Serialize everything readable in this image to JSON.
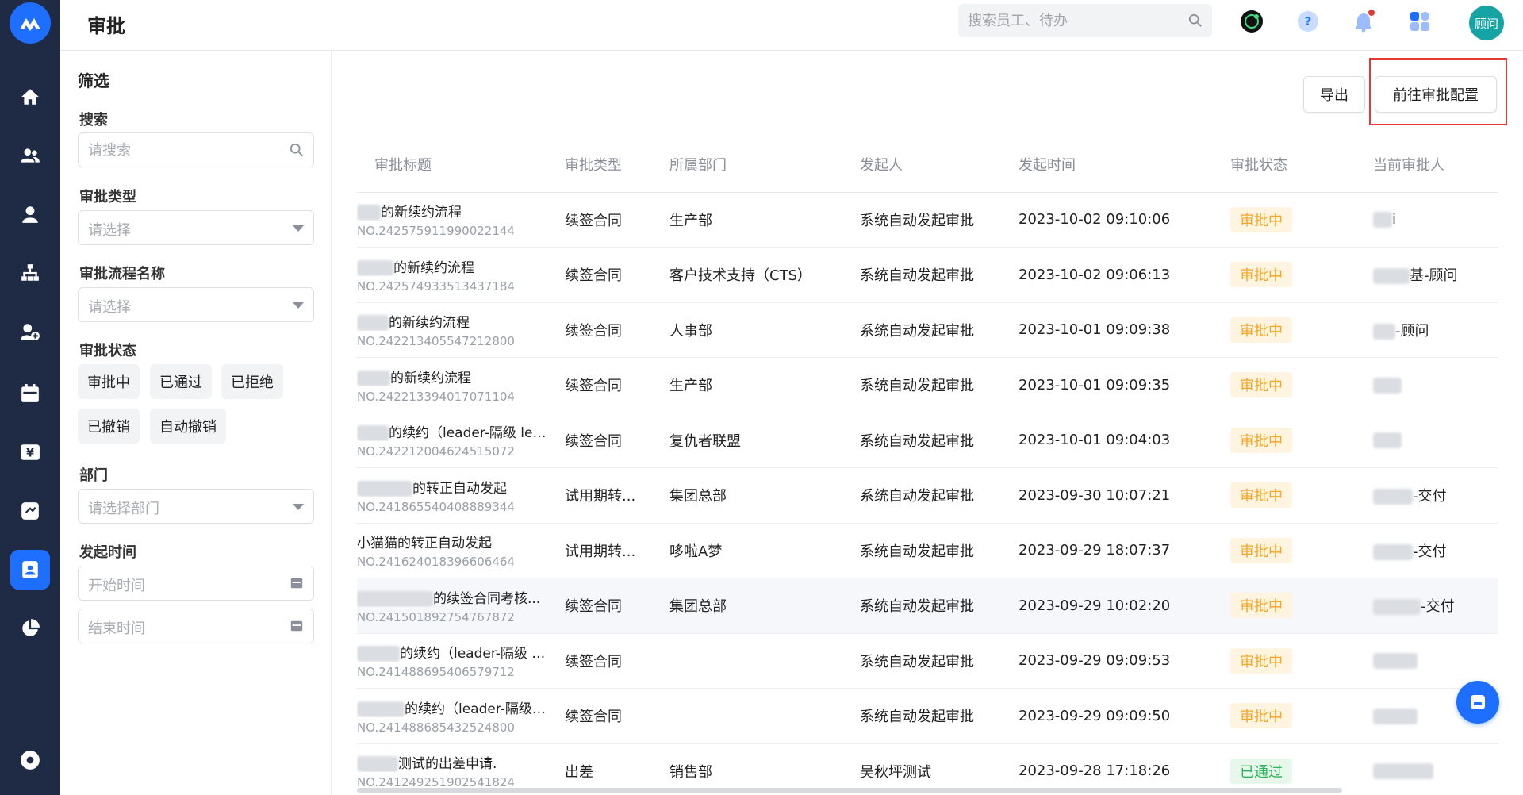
{
  "app": {
    "title": "审批"
  },
  "header": {
    "search_placeholder": "搜索员工、待办",
    "user_avatar": "顾问",
    "icons": [
      "ai-assistant-icon",
      "help-icon",
      "bell-icon",
      "apps-grid-icon"
    ]
  },
  "nav": {
    "items": [
      "home-icon",
      "users-icon",
      "user-icon",
      "org-chart-icon",
      "user-add-icon",
      "calendar-icon",
      "yen-icon",
      "exchange-icon",
      "approval-icon",
      "pie-chart-icon",
      "settings-icon"
    ],
    "active": "approval-icon"
  },
  "filter": {
    "title": "筛选",
    "search_label": "搜索",
    "search_placeholder": "请搜索",
    "type_label": "审批类型",
    "type_placeholder": "请选择",
    "flow_label": "审批流程名称",
    "flow_placeholder": "请选择",
    "status_label": "审批状态",
    "status_chips": [
      "审批中",
      "已通过",
      "已拒绝",
      "已撤销",
      "自动撤销"
    ],
    "dept_label": "部门",
    "dept_placeholder": "请选择部门",
    "time_label": "发起时间",
    "start_placeholder": "开始时间",
    "end_placeholder": "结束时间"
  },
  "toolbar": {
    "export_label": "导出",
    "config_label": "前往审批配置"
  },
  "table": {
    "columns": [
      "审批标题",
      "审批类型",
      "所属部门",
      "发起人",
      "发起时间",
      "审批状态",
      "当前审批人"
    ],
    "rows": [
      {
        "title": "的新续约流程",
        "no": "NO.242575911990022144",
        "type": "续签合同",
        "dept": "生产部",
        "initiator": "系统自动发起审批",
        "time": "2023-10-02 09:10:06",
        "status": "审批中",
        "approver": "i"
      },
      {
        "title": "的新续约流程",
        "no": "NO.242574933513437184",
        "type": "续签合同",
        "dept": "客户技术支持（CTS）",
        "initiator": "系统自动发起审批",
        "time": "2023-10-02 09:06:13",
        "status": "审批中",
        "approver": "基-顾问"
      },
      {
        "title": "的新续约流程",
        "no": "NO.242213405547212800",
        "type": "续签合同",
        "dept": "人事部",
        "initiator": "系统自动发起审批",
        "time": "2023-10-01 09:09:38",
        "status": "审批中",
        "approver": "-顾问"
      },
      {
        "title": "的新续约流程",
        "no": "NO.242213394017071104",
        "type": "续签合同",
        "dept": "生产部",
        "initiator": "系统自动发起审批",
        "time": "2023-10-01 09:09:35",
        "status": "审批中",
        "approver": ""
      },
      {
        "title": "的续约（leader-隔级 lea...",
        "no": "NO.242212004624515072",
        "type": "续签合同",
        "dept": "复仇者联盟",
        "initiator": "系统自动发起审批",
        "time": "2023-10-01 09:04:03",
        "status": "审批中",
        "approver": ""
      },
      {
        "title": "的转正自动发起",
        "no": "NO.241865540408889344",
        "type": "试用期转...",
        "dept": "集团总部",
        "initiator": "系统自动发起审批",
        "time": "2023-09-30 10:07:21",
        "status": "审批中",
        "approver": "-交付"
      },
      {
        "title": "小猫猫的转正自动发起",
        "no": "NO.241624018396606464",
        "type": "试用期转...",
        "dept": "哆啦A梦",
        "initiator": "系统自动发起审批",
        "time": "2023-09-29 18:07:37",
        "status": "审批中",
        "approver": "-交付"
      },
      {
        "title": "的续签合同考核...",
        "no": "NO.241501892754767872",
        "type": "续签合同",
        "dept": "集团总部",
        "initiator": "系统自动发起审批",
        "time": "2023-09-29 10:02:20",
        "status": "审批中",
        "approver": "-交付"
      },
      {
        "title": "的续约（leader-隔级 l...",
        "no": "NO.241488695406579712",
        "type": "续签合同",
        "dept": "",
        "initiator": "系统自动发起审批",
        "time": "2023-09-29 09:09:53",
        "status": "审批中",
        "approver": ""
      },
      {
        "title": "的续约（leader-隔级 l...",
        "no": "NO.241488685432524800",
        "type": "续签合同",
        "dept": "",
        "initiator": "系统自动发起审批",
        "time": "2023-09-29 09:09:50",
        "status": "审批中",
        "approver": ""
      },
      {
        "title": "测试的出差申请.",
        "no": "NO.241249251902541824",
        "type": "出差",
        "dept": "销售部",
        "initiator": "吴秋坪测试",
        "time": "2023-09-28 17:18:26",
        "status": "已通过",
        "approver": ""
      }
    ]
  },
  "colors": {
    "accent": "#1e6fff",
    "nav_bg": "#1f2a44",
    "pending": "#f5a524",
    "approved": "#2fb35a",
    "highlight_border": "#e53935"
  }
}
